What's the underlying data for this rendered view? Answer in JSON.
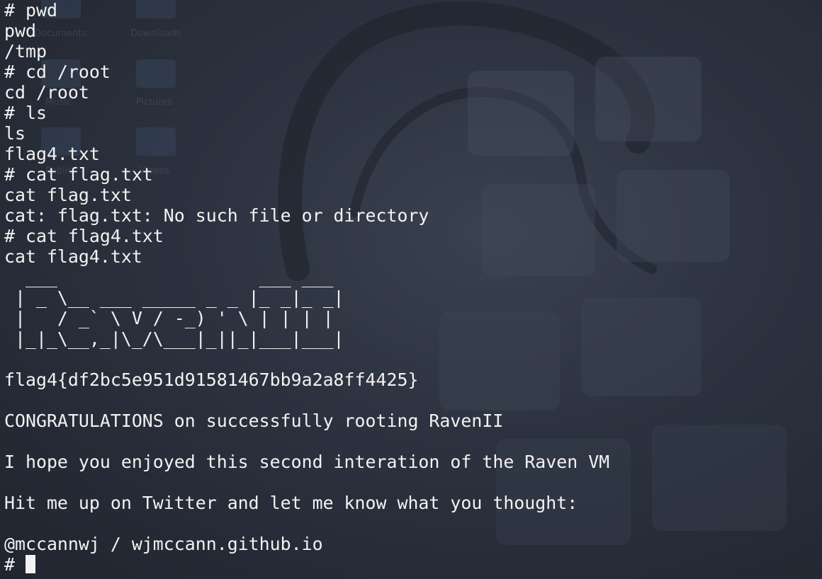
{
  "terminal": {
    "pre_lines": [
      "# pwd",
      "pwd",
      "/tmp",
      "# cd /root",
      "cd /root",
      "# ls",
      "ls",
      "flag4.txt",
      "# cat flag.txt",
      "cat flag.txt",
      "cat: flag.txt: No such file or directory",
      "# cat flag4.txt",
      "cat flag4.txt"
    ],
    "ascii_banner": [
      "  ___                   ___ ___ ",
      " | _ \\__ ___ _____ _ _ |_ _|_ _|",
      " |   / _` \\ V / -_) ' \\ | | | | ",
      " |_|_\\__,_|\\_/\\___|_||_|___|___|"
    ],
    "flag_line": "flag4{df2bc5e951d91581467bb9a2a8ff4425}",
    "congrats_line": "CONGRATULATIONS on successfully rooting RavenII",
    "hope_line": "I hope you enjoyed this second interation of the Raven VM",
    "twitter_line": "Hit me up on Twitter and let me know what you thought:",
    "handle_line": "@mccannwj / wjmccann.github.io",
    "prompt": "# "
  },
  "background": {
    "desktop_icons": [
      {
        "label": "Documents"
      },
      {
        "label": "Downloads"
      },
      {
        "label": "Music"
      },
      {
        "label": "Pictures"
      },
      {
        "label": "Public"
      },
      {
        "label": "Videos"
      }
    ],
    "colors": {
      "terminal_bg": "#2a303d",
      "text": "#f2f2f2"
    }
  }
}
